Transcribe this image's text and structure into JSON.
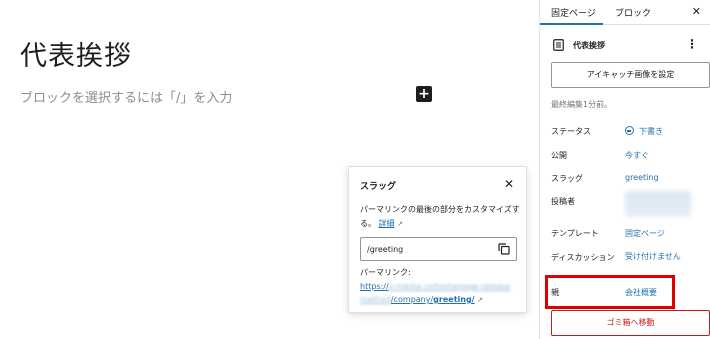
{
  "editor": {
    "post_title": "代表挨拶",
    "block_placeholder": "ブロックを選択するには「/」を入力",
    "inserter_symbol": "+"
  },
  "slug_popover": {
    "title": "スラッグ",
    "close_symbol": "✕",
    "description": "パーマリンクの最後の部分をカスタマイズする。",
    "details_link": "詳細",
    "external_symbol": "↗",
    "slug_value": "/greeting",
    "permalink_label": "パーマリンク:",
    "permalink_line1": "https://",
    "permalink_line1_blurred": "v-media.co/homepage-release",
    "permalink_line2_blurred": "method",
    "permalink_line2_visible": "/company/",
    "permalink_line2_slug": "greeting/"
  },
  "sidebar": {
    "tabs": [
      {
        "label": "固定ページ",
        "active": true
      },
      {
        "label": "ブロック",
        "active": false
      }
    ],
    "close_symbol": "✕",
    "doc_title": "代表挨拶",
    "kebab_symbol": "⋮",
    "featured_image_button": "アイキャッチ画像を設定",
    "last_edited": "最終編集1分前。",
    "rows": {
      "status": {
        "label": "ステータス",
        "value": "下書き"
      },
      "publish": {
        "label": "公開",
        "value": "今すぐ"
      },
      "slug": {
        "label": "スラッグ",
        "value": "greeting"
      },
      "author": {
        "label": "投稿者",
        "value": ""
      },
      "template": {
        "label": "テンプレート",
        "value": "固定ページ"
      },
      "discussion": {
        "label": "ディスカッション",
        "value": "受け付けません"
      },
      "parent": {
        "label": "親",
        "value": "会社概要"
      }
    },
    "trash_button": "ゴミ箱へ移動"
  },
  "colors": {
    "accent": "#2271b1",
    "highlight": "#e00000",
    "destructive": "#cc1818"
  }
}
